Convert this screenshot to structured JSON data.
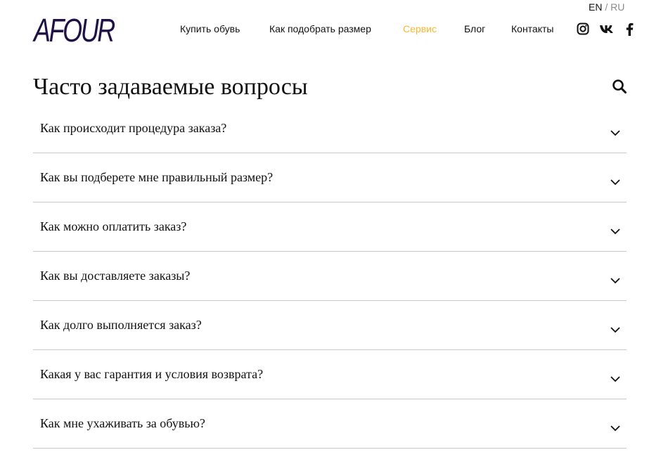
{
  "header": {
    "logo": "AFOUR",
    "lang": {
      "en": "EN",
      "sep": "/",
      "ru": "RU"
    },
    "nav": [
      {
        "label": "Купить обувь"
      },
      {
        "label": "Как подобрать размер"
      },
      {
        "label": "Сервис",
        "active": true
      },
      {
        "label": "Блог"
      },
      {
        "label": "Контакты"
      }
    ],
    "social": [
      "instagram-icon",
      "vk-icon",
      "facebook-icon"
    ],
    "accent_color": "#f7b733",
    "logo_color": "#1f1146"
  },
  "main": {
    "title": "Часто задаваемые вопросы",
    "faq": [
      {
        "question": "Как происходит процедура заказа?"
      },
      {
        "question": "Как вы подберете мне правильный размер?"
      },
      {
        "question": "Как можно оплатить заказ?"
      },
      {
        "question": "Как вы доставляете заказы?"
      },
      {
        "question": "Как долго выполняется заказ?"
      },
      {
        "question": "Какая у вас гарантия и условия возврата?"
      },
      {
        "question": "Как мне ухаживать за обувью?"
      }
    ]
  }
}
